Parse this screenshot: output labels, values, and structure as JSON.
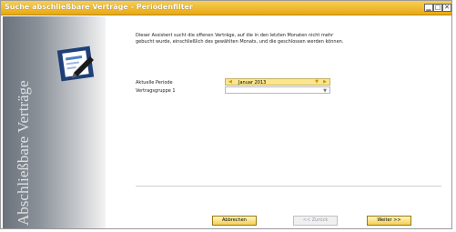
{
  "window": {
    "title": "Suche abschließbare Verträge - Periodenfilter"
  },
  "sidebar": {
    "vertical_text": "Abschließbare Verträge",
    "logo": "document-pen-icon"
  },
  "main": {
    "description": "Dieser Assistent sucht die offenen Verträge, auf die in den letzten Monaten nicht mehr gebucht wurde, einschließlich des gewählten Monats, und die geschlossen werden können.",
    "period_label": "Aktuelle Periode",
    "period_value": "Januar 2013",
    "group_label": "Vertragsgruppe 1",
    "group_value": ""
  },
  "buttons": {
    "cancel": "Abbrechen",
    "back": "<< Zurück",
    "next": "Weiter >>"
  },
  "colors": {
    "title_bar": "#f0b832",
    "period_field": "#fbe68d",
    "button": "#f3cf53"
  }
}
